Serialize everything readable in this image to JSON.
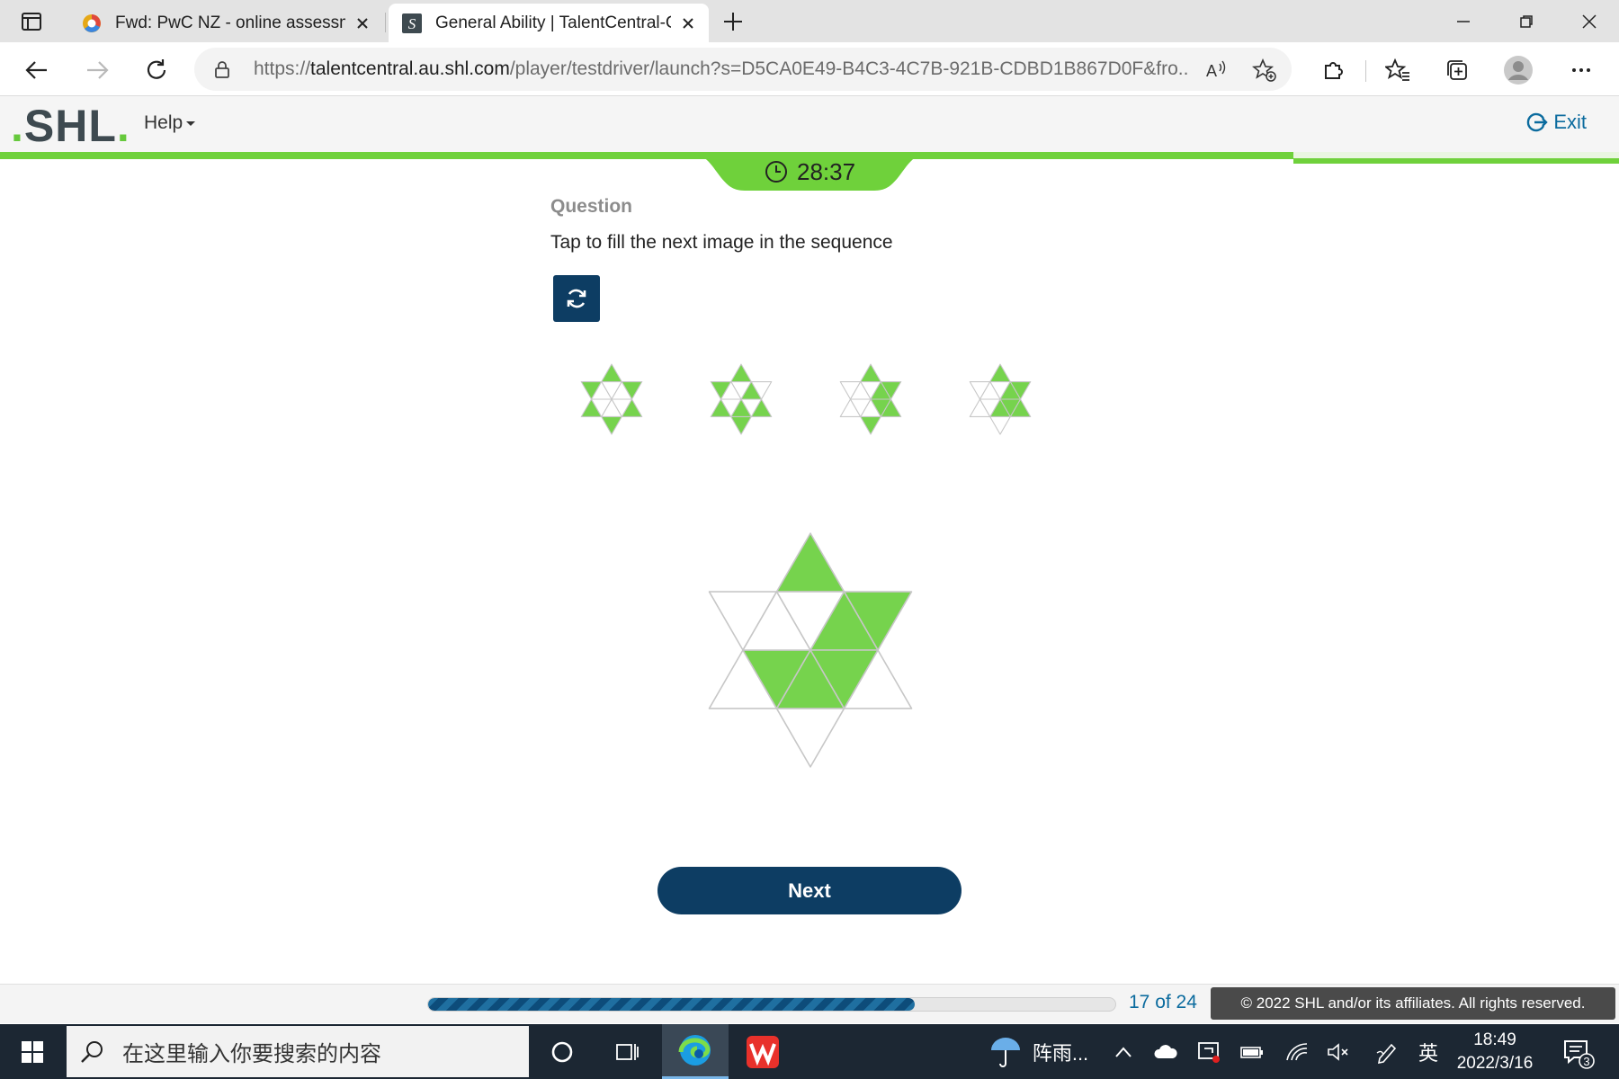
{
  "browser": {
    "tabs": [
      {
        "title": "Fwd: PwC NZ - online assessmen",
        "active": false
      },
      {
        "title": "General Ability | TalentCentral-Ca",
        "active": true
      }
    ],
    "url_prefix": "https://",
    "url_host": "talentcentral.au.shl.com",
    "url_rest": "/player/testdriver/launch?s=D5CA0E49-B4C3-4C7B-921B-CDBD1B867D0F&fro..."
  },
  "app": {
    "logo": "SHL",
    "help_label": "Help",
    "exit_label": "Exit",
    "timer": "28:37"
  },
  "question": {
    "label": "Question",
    "prompt": "Tap to fill the next image in the sequence"
  },
  "next_label": "Next",
  "footer": {
    "progress_fraction": 0.708,
    "count": "17 of 24",
    "copyright": "© 2022 SHL and/or its affiliates. All rights reserved."
  },
  "taskbar": {
    "search_placeholder": "在这里输入你要搜索的内容",
    "weather": "阵雨...",
    "ime": "英",
    "time": "18:49",
    "date": "2022/3/16",
    "notifications": "3"
  },
  "colors": {
    "fill": "#76d34d",
    "navy": "#0d3d63",
    "accent_green": "#6fd13b",
    "link_blue": "#0b6b9e"
  }
}
